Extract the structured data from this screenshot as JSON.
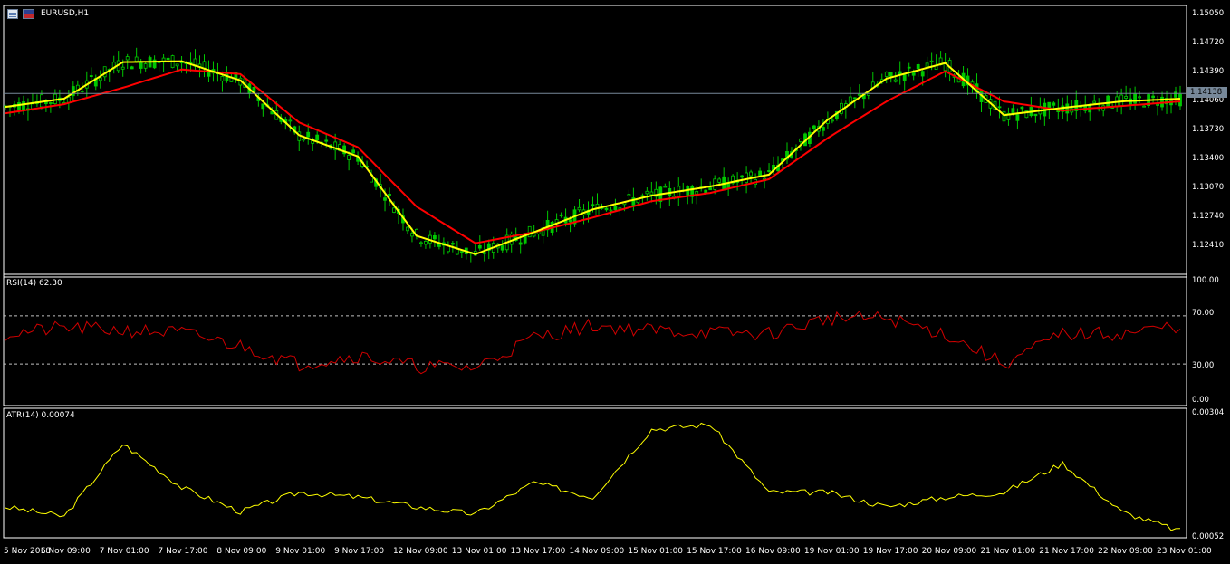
{
  "window": {
    "symbol": "EURUSD,H1"
  },
  "price_axis": {
    "labels": [
      "1.15050",
      "1.14720",
      "1.14390",
      "1.14060",
      "1.13730",
      "1.13400",
      "1.13070",
      "1.12740",
      "1.12410"
    ],
    "current_price": "1.14138"
  },
  "rsi": {
    "title": "RSI(14) 62.30",
    "levels": [
      "100.00",
      "70.00",
      "30.00",
      "0.00"
    ]
  },
  "atr": {
    "title": "ATR(14) 0.00074",
    "levels": [
      "0.00304",
      "0.00052"
    ]
  },
  "time_axis": [
    "5 Nov 2018",
    "6 Nov 09:00",
    "7 Nov 01:00",
    "7 Nov 17:00",
    "8 Nov 09:00",
    "9 Nov 01:00",
    "9 Nov 17:00",
    "12 Nov 09:00",
    "13 Nov 01:00",
    "13 Nov 17:00",
    "14 Nov 09:00",
    "15 Nov 01:00",
    "15 Nov 17:00",
    "16 Nov 09:00",
    "19 Nov 01:00",
    "19 Nov 17:00",
    "20 Nov 09:00",
    "21 Nov 01:00",
    "21 Nov 17:00",
    "22 Nov 09:00",
    "23 Nov 01:00"
  ],
  "colors": {
    "background": "#000000",
    "grid": "#ffffff",
    "bull_candle": "#00c800",
    "fast_ma": "#ffff00",
    "slow_ma": "#ff0000",
    "rsi_line": "#d00000",
    "atr_line": "#ffff00",
    "price_line": "#778899"
  },
  "icons": [
    "chart-window-icon",
    "eu-us-flag-icon"
  ],
  "chart_data": [
    {
      "type": "line",
      "title": "EURUSD,H1",
      "x": [
        "5 Nov 2018",
        "6 Nov 09:00",
        "7 Nov 01:00",
        "7 Nov 17:00",
        "8 Nov 09:00",
        "9 Nov 01:00",
        "9 Nov 17:00",
        "12 Nov 09:00",
        "13 Nov 01:00",
        "13 Nov 17:00",
        "14 Nov 09:00",
        "15 Nov 01:00",
        "15 Nov 17:00",
        "16 Nov 09:00",
        "19 Nov 01:00",
        "19 Nov 17:00",
        "20 Nov 09:00",
        "21 Nov 01:00",
        "21 Nov 17:00",
        "22 Nov 09:00",
        "23 Nov 01:00"
      ],
      "series": [
        {
          "values": [
            1.1399,
            1.1408,
            1.1448,
            1.1449,
            1.1428,
            1.1368,
            1.1345,
            1.1258,
            1.1238,
            1.1262,
            1.1287,
            1.1302,
            1.1312,
            1.1325,
            1.1385,
            1.143,
            1.1447,
            1.139,
            1.1398,
            1.1405,
            1.1408
          ]
        },
        {
          "values": [
            1.1392,
            1.1402,
            1.142,
            1.144,
            1.1435,
            1.1382,
            1.1355,
            1.129,
            1.125,
            1.1262,
            1.1278,
            1.1296,
            1.1305,
            1.132,
            1.1365,
            1.1405,
            1.1438,
            1.1405,
            1.1395,
            1.14,
            1.1405
          ]
        }
      ],
      "ylim": [
        1.1213,
        1.151
      ],
      "current_price": 1.14138
    },
    {
      "type": "line",
      "title": "RSI(14) 62.30",
      "x": [
        "5 Nov 2018",
        "6 Nov 09:00",
        "7 Nov 01:00",
        "7 Nov 17:00",
        "8 Nov 09:00",
        "9 Nov 01:00",
        "9 Nov 17:00",
        "12 Nov 09:00",
        "13 Nov 01:00",
        "13 Nov 17:00",
        "14 Nov 09:00",
        "15 Nov 01:00",
        "15 Nov 17:00",
        "16 Nov 09:00",
        "19 Nov 01:00",
        "19 Nov 17:00",
        "20 Nov 09:00",
        "21 Nov 01:00",
        "21 Nov 17:00",
        "22 Nov 09:00",
        "23 Nov 01:00"
      ],
      "series": [
        {
          "values": [
            55,
            60,
            58,
            56,
            45,
            30,
            37,
            28,
            27,
            52,
            62,
            58,
            56,
            55,
            68,
            68,
            55,
            30,
            55,
            55,
            62
          ]
        }
      ],
      "ylim": [
        0,
        100
      ],
      "levels": [
        30,
        70
      ]
    },
    {
      "type": "line",
      "title": "ATR(14) 0.00074",
      "x": [
        "5 Nov 2018",
        "6 Nov 09:00",
        "7 Nov 01:00",
        "7 Nov 17:00",
        "8 Nov 09:00",
        "9 Nov 01:00",
        "9 Nov 17:00",
        "12 Nov 09:00",
        "13 Nov 01:00",
        "13 Nov 17:00",
        "14 Nov 09:00",
        "15 Nov 01:00",
        "15 Nov 17:00",
        "16 Nov 09:00",
        "19 Nov 01:00",
        "19 Nov 17:00",
        "20 Nov 09:00",
        "21 Nov 01:00",
        "21 Nov 17:00",
        "22 Nov 09:00",
        "23 Nov 01:00"
      ],
      "series": [
        {
          "values": [
            0.0011,
            0.0009,
            0.0024,
            0.0015,
            0.001,
            0.0014,
            0.0013,
            0.0011,
            0.00095,
            0.0016,
            0.0013,
            0.0027,
            0.0028,
            0.0014,
            0.0014,
            0.0011,
            0.0013,
            0.0014,
            0.002,
            0.001,
            0.0006
          ]
        }
      ],
      "ylim": [
        0.00052,
        0.00304
      ]
    }
  ]
}
